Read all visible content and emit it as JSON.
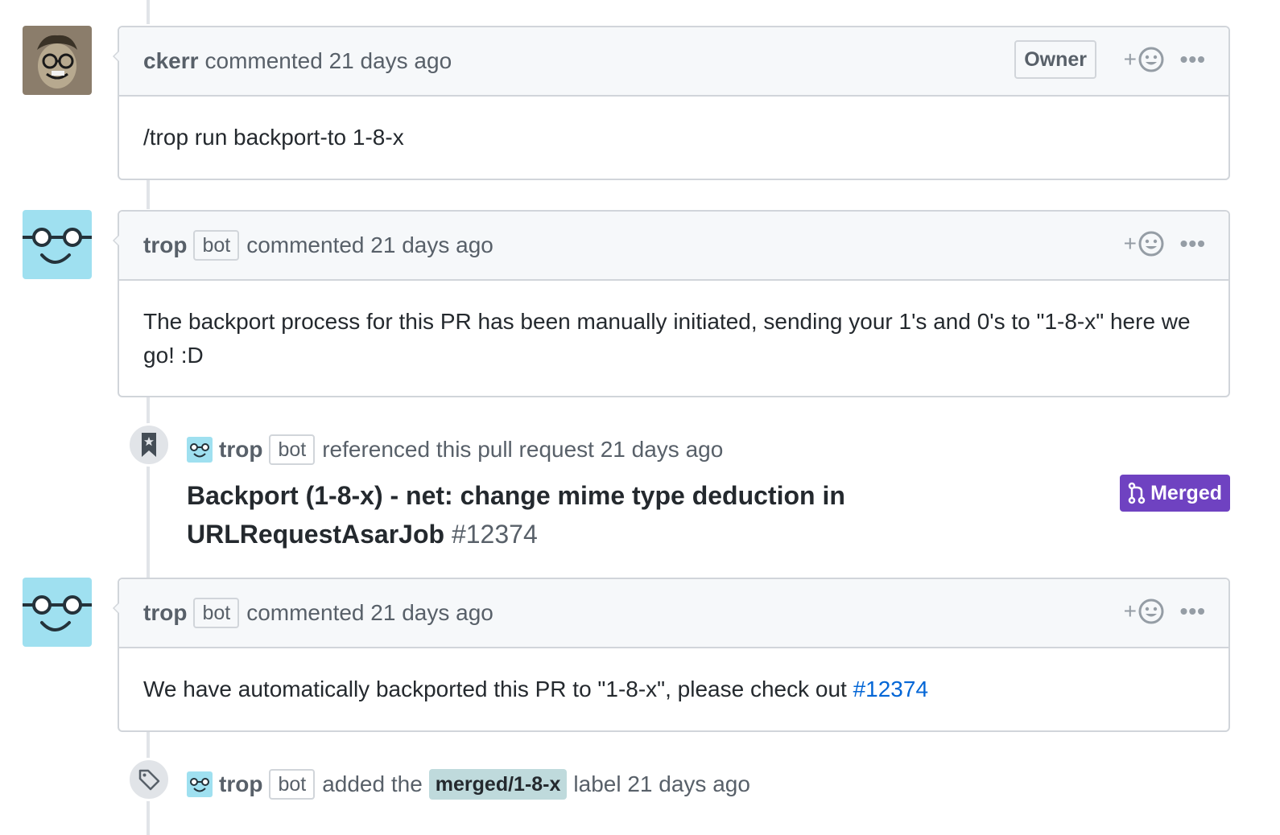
{
  "comments": [
    {
      "author": "ckerr",
      "meta": "commented 21 days ago",
      "owner_badge": "Owner",
      "body": "/trop run backport-to 1-8-x"
    },
    {
      "author": "trop",
      "bot_label": "bot",
      "meta": "commented 21 days ago",
      "body": "The backport process for this PR has been manually initiated, sending your 1's and 0's to \"1-8-x\" here we go! :D"
    },
    {
      "author": "trop",
      "bot_label": "bot",
      "meta": "commented 21 days ago",
      "body_prefix": "We have automatically backported this PR to \"1-8-x\", please check out ",
      "body_link": "#12374"
    }
  ],
  "reference_event": {
    "author": "trop",
    "bot_label": "bot",
    "text": "referenced this pull request 21 days ago",
    "pr_title": "Backport (1-8-x) - net: change mime type deduction in URLRequestAsarJob",
    "pr_number": "#12374",
    "status": "Merged"
  },
  "label_event": {
    "author": "trop",
    "bot_label": "bot",
    "text_before": "added the",
    "label": "merged/1-8-x",
    "text_after": "label 21 days ago"
  },
  "reaction_plus": "+",
  "more_glyph": "•••",
  "colors": {
    "merged": "#6f42c1",
    "label_bg": "#bfdadc",
    "link": "#0366d6",
    "trop_avatar_bg": "#9fe0f0"
  },
  "icons": {
    "reaction": "smiley-icon",
    "reference": "bookmark-icon",
    "label": "tag-icon",
    "merged": "git-merge-icon"
  }
}
